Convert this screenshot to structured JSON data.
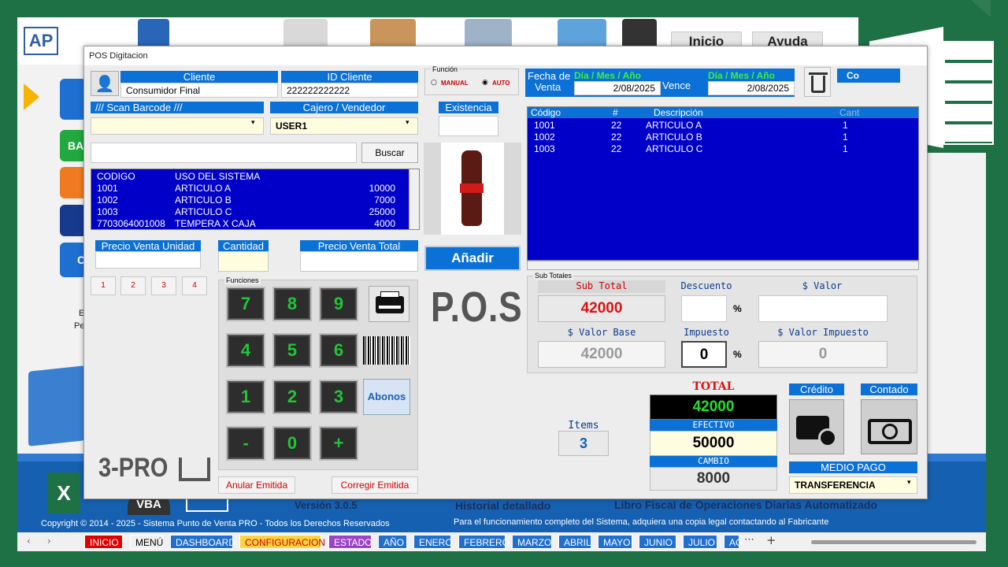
{
  "background": {
    "logo_text": "AP",
    "top_buttons": [
      "Inicio",
      "Ayuda"
    ],
    "side_label_ba": "BA",
    "side_label_c": "C",
    "side_text_1": "E",
    "side_text_2": "Pe",
    "footer_version": "Versión 3.0.5",
    "footer_history": "Historial detallado",
    "footer_libro": "Libro Fiscal de Operaciones Diarias Automatizado",
    "copyright": "Copyright © 2014 - 2025 - Sistema Punto de Venta PRO - Todos los Derechos Reservados",
    "license_note": "Para el funcionamiento completo del Sistema, adquiera una copia legal contactando al Fabricante",
    "brand_3pro": "3-PRO",
    "vba_label": "VBA",
    "excel_x": "X"
  },
  "tabs": [
    "INICIO",
    "MENÚ",
    "DASHBOARD",
    "CONFIGURACION",
    "ESTADO",
    "AÑO",
    "ENERO",
    "FEBRERO",
    "MARZO",
    "ABRIL",
    "MAYO",
    "JUNIO",
    "JULIO",
    "AG"
  ],
  "tab_colors": [
    "#e00000",
    "#f0f0f0",
    "#1f6fd1",
    "#ffd33d",
    "#9b43c8",
    "#1f6fd1",
    "#1f6fd1",
    "#1f6fd1",
    "#1f6fd1",
    "#1f6fd1",
    "#1f6fd1",
    "#1f6fd1",
    "#1f6fd1",
    "#1f6fd1"
  ],
  "window": {
    "title": "POS Digitacion",
    "cliente_label": "Cliente",
    "cliente_value": "Consumidor Final",
    "id_cliente_label": "ID Cliente",
    "id_cliente_value": "222222222222",
    "funcion_label": "Función",
    "manual_label": "MANUAL",
    "auto_label": "AUTO",
    "scan_label": "/// Scan Barcode ///",
    "cajero_label": "Cajero / Vendedor",
    "cajero_value": "USER1",
    "existencia_label": "Existencia",
    "buscar_label": "Buscar",
    "products": [
      {
        "code": "CODIGO",
        "desc": "USO DEL SISTEMA",
        "price": ""
      },
      {
        "code": "1001",
        "desc": "ARTICULO A",
        "price": "10000"
      },
      {
        "code": "1002",
        "desc": "ARTICULO B",
        "price": "7000"
      },
      {
        "code": "1003",
        "desc": "ARTICULO C",
        "price": "25000"
      },
      {
        "code": "7703064001008",
        "desc": "TEMPERA X CAJA",
        "price": "4000"
      }
    ],
    "precio_unidad_label": "Precio Venta Unidad",
    "cantidad_label": "Cantidad",
    "precio_total_label": "Precio Venta  Total",
    "anadir_label": "Añadir",
    "quick_buttons": [
      "1",
      "2",
      "3",
      "4"
    ],
    "funciones_label": "Funciones",
    "keypad": [
      "7",
      "8",
      "9",
      "4",
      "5",
      "6",
      "1",
      "2",
      "3",
      "-",
      "0",
      "+"
    ],
    "abonos_label": "Abonos",
    "pos_label": "P.O.S",
    "anular_label": "Anular Emitida",
    "corregir_label": "Corregir Emitida",
    "fecha_label": "Fecha de",
    "fecha_format": "Día / Mes / Año",
    "venta_label": "Venta",
    "venta_value": "2/08/2025",
    "vence_label": "Vence",
    "vence_value": "2/08/2025",
    "co_label": "Co",
    "table_headers": [
      "Código",
      "#",
      "Descripción",
      "Cant"
    ],
    "table_rows": [
      {
        "code": "1001",
        "num": "22",
        "desc": "ARTICULO A",
        "qty": "1"
      },
      {
        "code": "1002",
        "num": "22",
        "desc": "ARTICULO B",
        "qty": "1"
      },
      {
        "code": "1003",
        "num": "22",
        "desc": "ARTICULO C",
        "qty": "1"
      }
    ],
    "subtotales_label": "Sub Totales",
    "subtotal_label": "Sub Total",
    "subtotal_value": "42000",
    "descuento_label": "Descuento",
    "valor_label": "$ Valor",
    "percent": "%",
    "valor_base_label": "$ Valor Base",
    "valor_base_value": "42000",
    "impuesto_label": "Impuesto",
    "impuesto_value": "0",
    "valor_impuesto_label": "$ Valor Impuesto",
    "valor_impuesto_value": "0",
    "items_label": "Items",
    "items_value": "3",
    "total_label": "TOTAL",
    "total_value": "42000",
    "efectivo_label": "EFECTIVO",
    "efectivo_value": "50000",
    "cambio_label": "CAMBIO",
    "cambio_value": "8000",
    "credito_label": "Crédito",
    "contado_label": "Contado",
    "medio_pago_label": "MEDIO PAGO",
    "medio_pago_value": "TRANSFERENCIA"
  }
}
